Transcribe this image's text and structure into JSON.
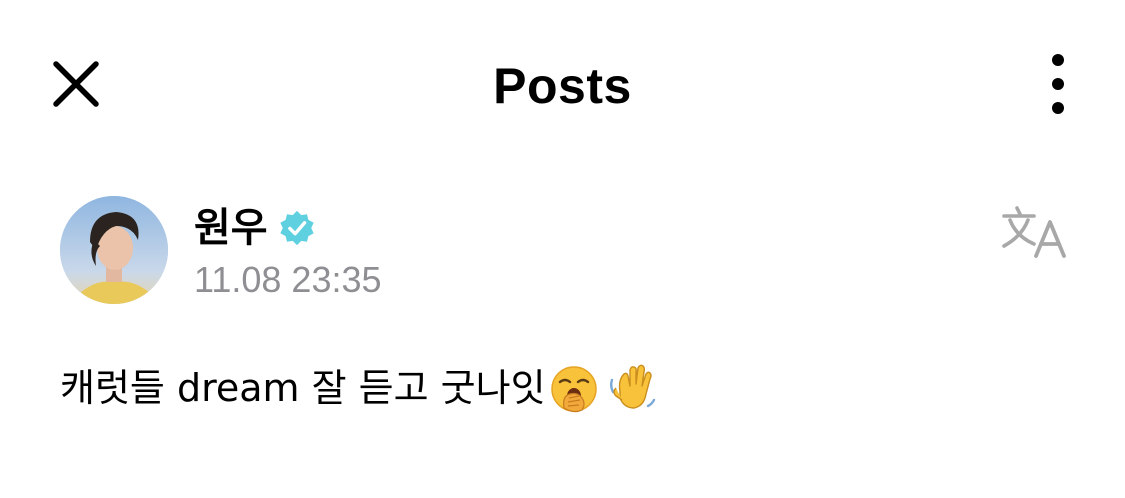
{
  "header": {
    "title": "Posts",
    "close_icon": "close-icon",
    "more_icon": "more-vertical-icon"
  },
  "post": {
    "author": {
      "name": "원우",
      "verified": true,
      "verified_color": "#5fd0df",
      "avatar_icon": "user-avatar"
    },
    "timestamp": "11.08 23:35",
    "translate_icon": "translate-icon",
    "text": "캐럿들 dream 잘 듣고 굿나잇",
    "emojis": [
      "yawning-face-emoji",
      "waving-hand-emoji"
    ]
  },
  "colors": {
    "background": "#ffffff",
    "text": "#000000",
    "muted": "#8e8e93",
    "icon_gray": "#a8a8a8"
  }
}
